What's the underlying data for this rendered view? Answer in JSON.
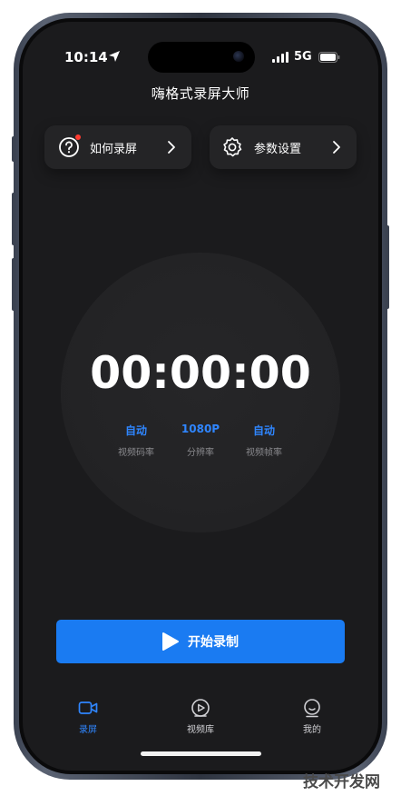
{
  "status_bar": {
    "time": "10:14",
    "network": "5G"
  },
  "app": {
    "title": "嗨格式录屏大师"
  },
  "cards": {
    "how_to_record": {
      "label": "如何录屏",
      "has_notification_dot": true
    },
    "settings": {
      "label": "参数设置"
    }
  },
  "timer": {
    "value": "00:00:00"
  },
  "metrics": [
    {
      "value": "自动",
      "label": "视频码率"
    },
    {
      "value": "1080P",
      "label": "分辨率"
    },
    {
      "value": "自动",
      "label": "视频帧率"
    }
  ],
  "start_button": {
    "label": "开始录制"
  },
  "tabs": [
    {
      "label": "录屏",
      "icon": "video-camera-icon",
      "active": true
    },
    {
      "label": "视频库",
      "icon": "play-circle-icon",
      "active": false
    },
    {
      "label": "我的",
      "icon": "user-icon",
      "active": false
    }
  ],
  "watermark": {
    "text": "技术开发网"
  },
  "colors": {
    "accent": "#1a7bf2",
    "accent_text": "#2f86ff",
    "background": "#1b1b1d",
    "card": "#242426",
    "notification_dot": "#ff3b30"
  }
}
